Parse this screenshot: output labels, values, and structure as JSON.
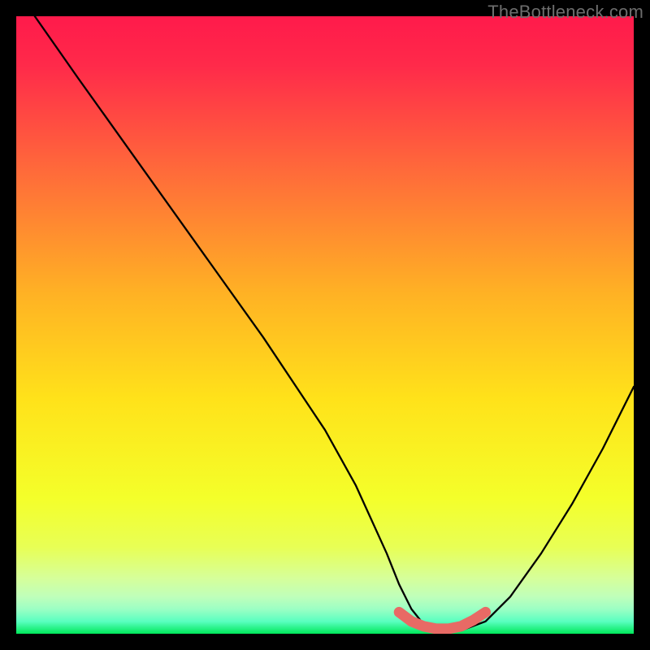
{
  "watermark": "TheBottleneck.com",
  "colors": {
    "top": "#ff1a4b",
    "mid": "#ffd400",
    "bottom": "#00e85a",
    "curve_stroke": "#000000",
    "highlight": "#e86a65"
  },
  "chart_data": {
    "type": "line",
    "title": "",
    "xlabel": "",
    "ylabel": "",
    "xlim": [
      0,
      100
    ],
    "ylim": [
      0,
      100
    ],
    "curve": {
      "x": [
        3,
        10,
        20,
        30,
        40,
        50,
        55,
        60,
        62,
        64,
        66,
        68,
        70,
        72,
        76,
        80,
        85,
        90,
        95,
        100
      ],
      "y": [
        100,
        90,
        76,
        62,
        48,
        33,
        24,
        13,
        8,
        4,
        1.5,
        0.5,
        0.3,
        0.5,
        2,
        6,
        13,
        21,
        30,
        40
      ]
    },
    "highlight_segment": {
      "x": [
        62,
        64,
        66,
        68,
        70,
        72,
        74,
        76
      ],
      "y": [
        3.5,
        2,
        1.2,
        0.8,
        0.8,
        1.2,
        2.2,
        3.5
      ]
    },
    "annotations": []
  }
}
